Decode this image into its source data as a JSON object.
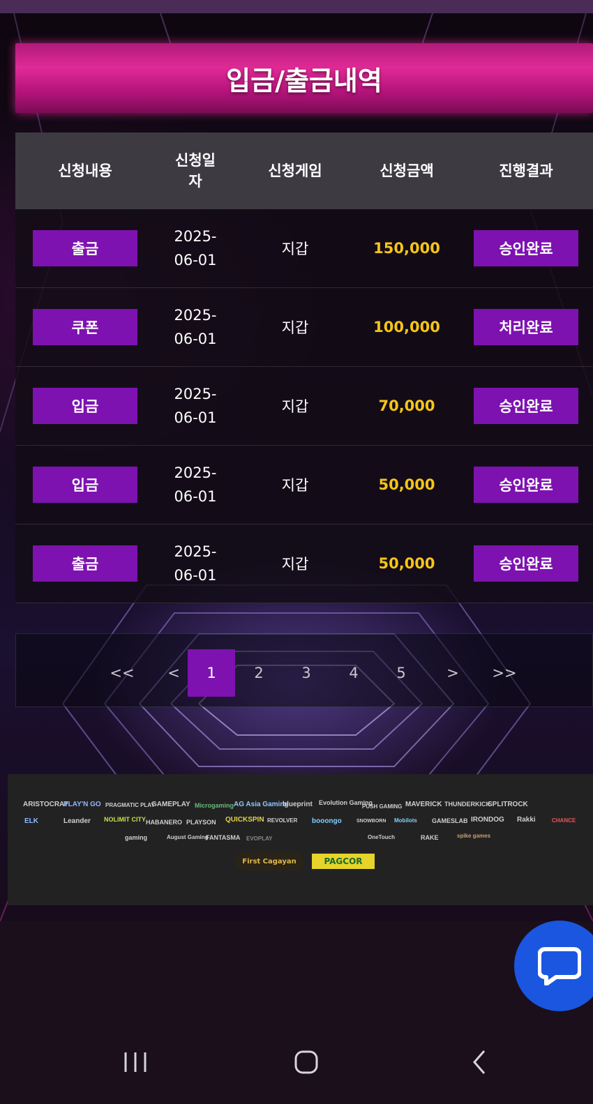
{
  "header": {
    "title": "입금/출금내역"
  },
  "table": {
    "columns": [
      "신청내용",
      "신청일\n자",
      "신청게임",
      "신청금액",
      "진행결과"
    ],
    "rows": [
      {
        "type": "출금",
        "date_line1": "2025-",
        "date_line2": "06-01",
        "game": "지갑",
        "amount": "150,000",
        "status": "승인완료"
      },
      {
        "type": "쿠폰",
        "date_line1": "2025-",
        "date_line2": "06-01",
        "game": "지갑",
        "amount": "100,000",
        "status": "처리완료"
      },
      {
        "type": "입금",
        "date_line1": "2025-",
        "date_line2": "06-01",
        "game": "지갑",
        "amount": "70,000",
        "status": "승인완료"
      },
      {
        "type": "입금",
        "date_line1": "2025-",
        "date_line2": "06-01",
        "game": "지갑",
        "amount": "50,000",
        "status": "승인완료"
      },
      {
        "type": "출금",
        "date_line1": "2025-",
        "date_line2": "06-01",
        "game": "지갑",
        "amount": "50,000",
        "status": "승인완료"
      }
    ]
  },
  "pagination": {
    "first": "<<",
    "prev": "<",
    "pages": [
      "1",
      "2",
      "3",
      "4",
      "5"
    ],
    "current": "1",
    "next": ">",
    "last": ">>"
  },
  "footer": {
    "providers_row1": [
      "ARISTOCRAT",
      "PLAY'N GO",
      "PRAGMATIC PLAY",
      "GAMEPLAY",
      "Microgaming",
      "AG Asia Gaming",
      "blueprint",
      "Evolution Gaming",
      "PUSH GAMING",
      "MAVERICK",
      "THUNDERKICK",
      "SPLITROCK"
    ],
    "providers_row2": [
      "ELK",
      "Leander",
      "NOLIMIT CITY",
      "HABANERO",
      "PLAYSON",
      "QUICKSPIN",
      "REVOLVER",
      "booongo",
      "SNOWBORN",
      "Mobilots",
      "GAMESLAB",
      "IRONDOG",
      "Rakki",
      "CHANCE"
    ],
    "providers_row3": [
      "gaming",
      "August Gaming",
      "FANTASMA",
      "EVOPLAY",
      "OneTouch",
      "RAKE",
      "spike games"
    ],
    "certifications": [
      "First Cagayan",
      "PAGCOR"
    ]
  },
  "colors": {
    "accent_purple": "#7d12b0",
    "title_pink": "#e02a96",
    "amount_yellow": "#f5c518",
    "chat_blue": "#1a56e0"
  },
  "icons": {
    "chat": "chat-bubble-icon",
    "nav_recent": "recent-apps-icon",
    "nav_home": "home-icon",
    "nav_back": "back-icon"
  }
}
